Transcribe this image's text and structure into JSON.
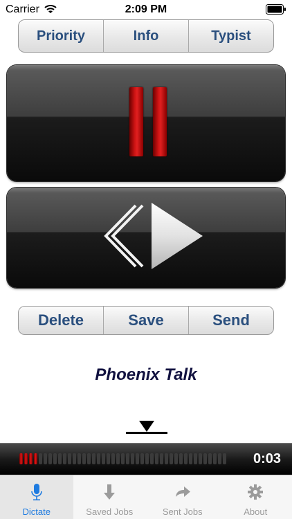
{
  "status": {
    "carrier": "Carrier",
    "time": "2:09 PM"
  },
  "top_segment": {
    "priority": "Priority",
    "info": "Info",
    "typist": "Typist"
  },
  "controls": {
    "pause_icon": "pause-icon",
    "play_icon": "rewind-play-icon"
  },
  "bottom_segment": {
    "delete": "Delete",
    "save": "Save",
    "send": "Send"
  },
  "title": "Phoenix Talk",
  "meter": {
    "time": "0:03",
    "level_fraction": 0.1
  },
  "tabs": [
    {
      "label": "Dictate",
      "icon": "microphone-icon",
      "active": true
    },
    {
      "label": "Saved Jobs",
      "icon": "download-arrow-icon"
    },
    {
      "label": "Sent Jobs",
      "icon": "forward-arrow-icon"
    },
    {
      "label": "About",
      "icon": "gear-icon"
    }
  ],
  "colors": {
    "accent": "#1e7be0",
    "segment_text": "#2a4f7e",
    "record_red": "#d01414"
  }
}
